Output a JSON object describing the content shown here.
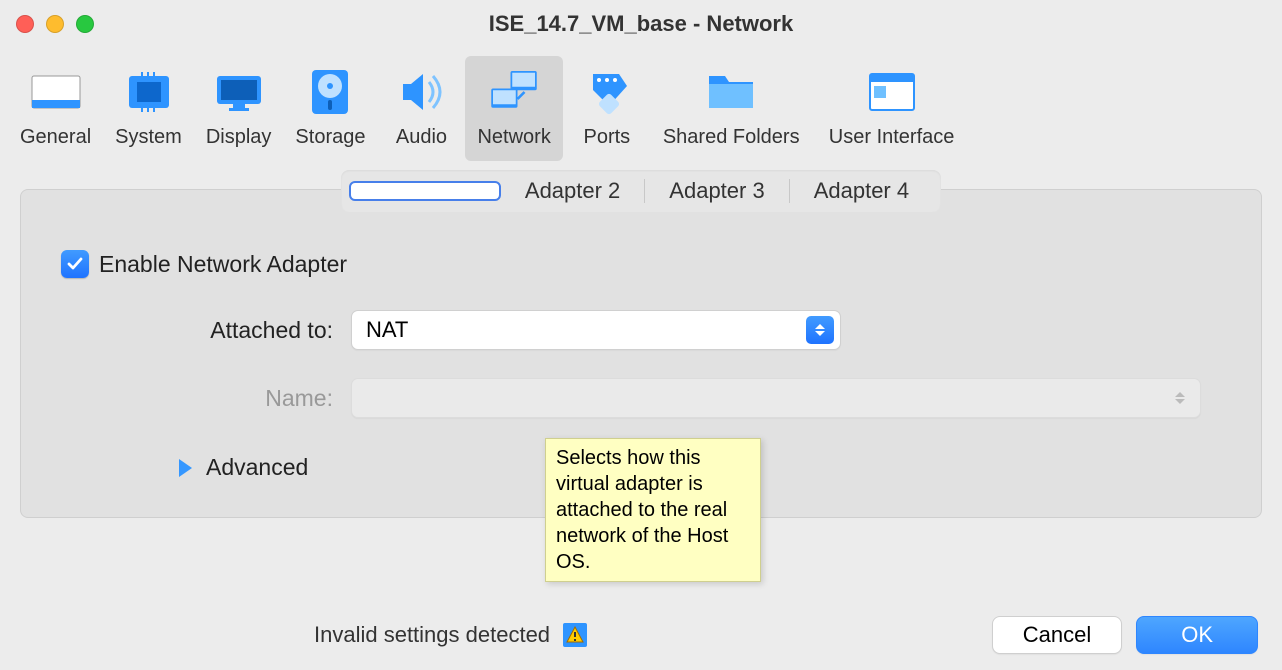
{
  "window": {
    "title": "ISE_14.7_VM_base - Network"
  },
  "toolbar": {
    "items": [
      {
        "label": "General"
      },
      {
        "label": "System"
      },
      {
        "label": "Display"
      },
      {
        "label": "Storage"
      },
      {
        "label": "Audio"
      },
      {
        "label": "Network"
      },
      {
        "label": "Ports"
      },
      {
        "label": "Shared Folders"
      },
      {
        "label": "User Interface"
      }
    ],
    "selected_index": 5
  },
  "adapter_tabs": {
    "tabs": [
      {
        "label": ""
      },
      {
        "label": "Adapter 2"
      },
      {
        "label": "Adapter 3"
      },
      {
        "label": "Adapter 4"
      }
    ],
    "active_index": 0
  },
  "form": {
    "enable_label": "Enable Network Adapter",
    "enable_checked": true,
    "attached_to_label": "Attached to:",
    "attached_to_value": "NAT",
    "name_label": "Name:",
    "name_value": "",
    "advanced_label": "Advanced"
  },
  "tooltip": {
    "text": "Selects how this virtual adapter is attached to the real network of the Host OS."
  },
  "footer": {
    "warning_text": "Invalid settings detected",
    "cancel_label": "Cancel",
    "ok_label": "OK"
  }
}
